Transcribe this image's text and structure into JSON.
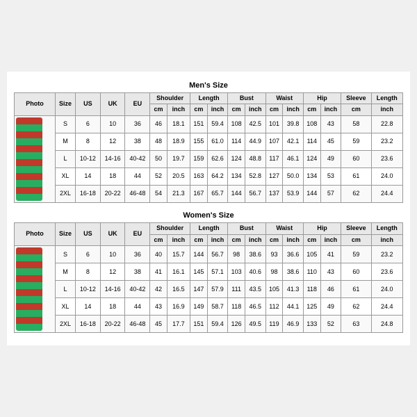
{
  "men": {
    "title": "Men's Size",
    "headers": [
      "Photo",
      "Size",
      "US",
      "UK",
      "EU",
      "Shoulder cm",
      "Shoulder inch",
      "Length cm",
      "Length inch",
      "Bust cm",
      "Bust inch",
      "Waist cm",
      "Waist inch",
      "Hip cm",
      "Hip inch",
      "Sleeve cm",
      "Length inch2"
    ],
    "subheaders": [
      "",
      "",
      "",
      "",
      "",
      "cm",
      "inch",
      "cm",
      "inch",
      "cm",
      "inch",
      "cm",
      "inch",
      "cm",
      "inch",
      "cm",
      "inch"
    ],
    "rows": [
      [
        "S",
        "6",
        "10",
        "36",
        "46",
        "18.1",
        "151",
        "59.4",
        "108",
        "42.5",
        "101",
        "39.8",
        "108",
        "43",
        "58",
        "22.8"
      ],
      [
        "M",
        "8",
        "12",
        "38",
        "48",
        "18.9",
        "155",
        "61.0",
        "114",
        "44.9",
        "107",
        "42.1",
        "114",
        "45",
        "59",
        "23.2"
      ],
      [
        "L",
        "10-12",
        "14-16",
        "40-42",
        "50",
        "19.7",
        "159",
        "62.6",
        "124",
        "48.8",
        "117",
        "46.1",
        "124",
        "49",
        "60",
        "23.6"
      ],
      [
        "XL",
        "14",
        "18",
        "44",
        "52",
        "20.5",
        "163",
        "64.2",
        "134",
        "52.8",
        "127",
        "50.0",
        "134",
        "53",
        "61",
        "24.0"
      ],
      [
        "2XL",
        "16-18",
        "20-22",
        "46-48",
        "54",
        "21.3",
        "167",
        "65.7",
        "144",
        "56.7",
        "137",
        "53.9",
        "144",
        "57",
        "62",
        "24.4"
      ]
    ]
  },
  "women": {
    "title": "Women's Size",
    "subheaders": [
      "",
      "",
      "",
      "",
      "",
      "cm",
      "inch",
      "cm",
      "inch",
      "cm",
      "inch",
      "cm",
      "inch",
      "cm",
      "inch",
      "cm",
      "inch"
    ],
    "rows": [
      [
        "S",
        "6",
        "10",
        "36",
        "40",
        "15.7",
        "144",
        "56.7",
        "98",
        "38.6",
        "93",
        "36.6",
        "105",
        "41",
        "59",
        "23.2"
      ],
      [
        "M",
        "8",
        "12",
        "38",
        "41",
        "16.1",
        "145",
        "57.1",
        "103",
        "40.6",
        "98",
        "38.6",
        "110",
        "43",
        "60",
        "23.6"
      ],
      [
        "L",
        "10-12",
        "14-16",
        "40-42",
        "42",
        "16.5",
        "147",
        "57.9",
        "111",
        "43.5",
        "105",
        "41.3",
        "118",
        "46",
        "61",
        "24.0"
      ],
      [
        "XL",
        "14",
        "18",
        "44",
        "43",
        "16.9",
        "149",
        "58.7",
        "118",
        "46.5",
        "112",
        "44.1",
        "125",
        "49",
        "62",
        "24.4"
      ],
      [
        "2XL",
        "16-18",
        "20-22",
        "46-48",
        "45",
        "17.7",
        "151",
        "59.4",
        "126",
        "49.5",
        "119",
        "46.9",
        "133",
        "52",
        "63",
        "24.8"
      ]
    ]
  }
}
